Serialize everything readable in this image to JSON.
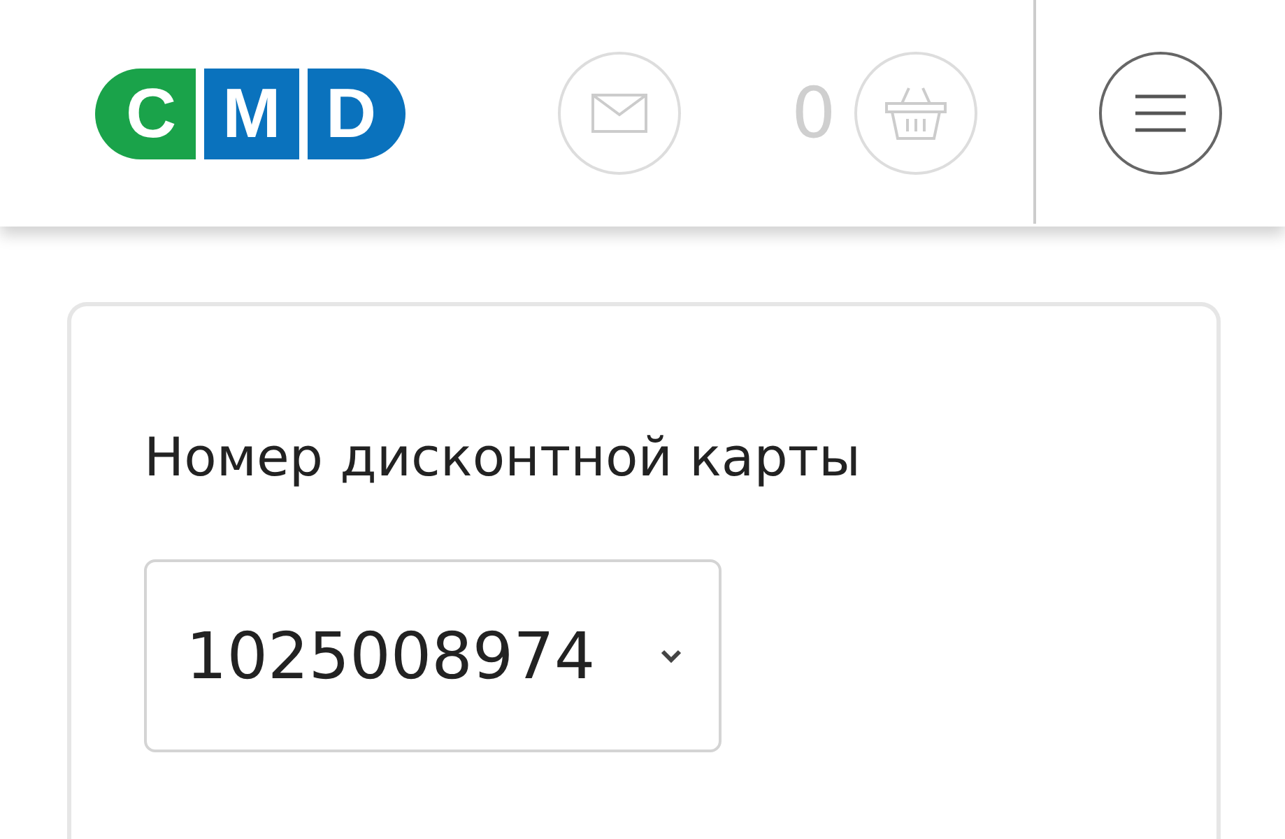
{
  "header": {
    "logo": [
      "C",
      "M",
      "D"
    ],
    "cart_count": "0"
  },
  "card": {
    "label": "Номер дисконтной карты",
    "select": {
      "value": "1025008974"
    }
  }
}
